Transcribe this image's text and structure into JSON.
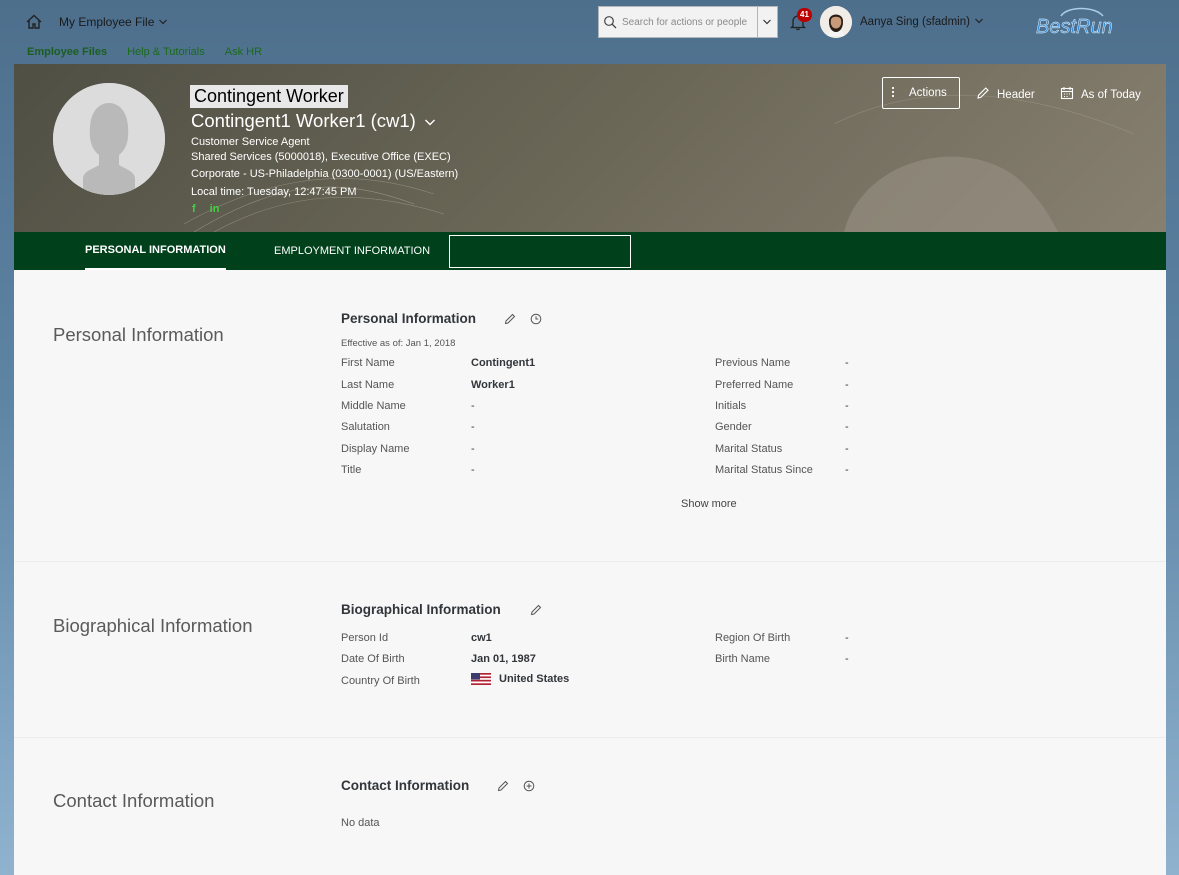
{
  "shell": {
    "menu_title": "My Employee File",
    "search_placeholder": "Search for actions or people",
    "notifications_count": "41",
    "user_name": "Aanya Sing (sfadmin)",
    "brand": "BestRun",
    "nav": [
      "Employee Files",
      "Help & Tutorials",
      "Ask HR"
    ]
  },
  "header": {
    "employee_type": "Contingent Worker",
    "employee_name": "Contingent1 Worker1 (cw1)",
    "job_title": "Customer Service Agent",
    "department": "Shared Services (5000018), Executive Office (EXEC)",
    "location": "Corporate - US-Philadelphia (0300-0001) (US/Eastern)",
    "local_time": "Local time: Tuesday, 12:47:45 PM",
    "social": [
      "f",
      "in"
    ],
    "actions_label": "Actions",
    "header_label": "Header",
    "as_of_label": "As of Today"
  },
  "tabs": [
    "PERSONAL INFORMATION",
    "EMPLOYMENT INFORMATION",
    ""
  ],
  "personal": {
    "section_title": "Personal Information",
    "block_title": "Personal Information",
    "effective": "Effective as of: Jan 1, 2018",
    "left_fields": [
      {
        "label": "First Name",
        "value": "Contingent1"
      },
      {
        "label": "Last Name",
        "value": "Worker1"
      },
      {
        "label": "Middle Name",
        "value": "-"
      },
      {
        "label": "Salutation",
        "value": "-"
      },
      {
        "label": "Display Name",
        "value": "-"
      },
      {
        "label": "Title",
        "value": "-"
      }
    ],
    "right_fields": [
      {
        "label": "Previous Name",
        "value": "-"
      },
      {
        "label": "Preferred Name",
        "value": "-"
      },
      {
        "label": "Initials",
        "value": "-"
      },
      {
        "label": "Gender",
        "value": "-"
      },
      {
        "label": "Marital Status",
        "value": "-"
      },
      {
        "label": "Marital Status Since",
        "value": "-"
      }
    ],
    "show_more": "Show more"
  },
  "biographical": {
    "section_title": "Biographical Information",
    "block_title": "Biographical Information",
    "left_fields": [
      {
        "label": "Person Id",
        "value": "cw1"
      },
      {
        "label": "Date Of Birth",
        "value": "Jan 01, 1987"
      },
      {
        "label": "Country Of Birth",
        "value": "United States"
      }
    ],
    "right_fields": [
      {
        "label": "Region Of Birth",
        "value": "-"
      },
      {
        "label": "Birth Name",
        "value": "-"
      }
    ]
  },
  "contact": {
    "section_title": "Contact Information",
    "block_title": "Contact Information",
    "no_data": "No data"
  },
  "colors": {
    "tab_bar": "#00401a",
    "nav_link": "#1b6a1b",
    "badge": "#bb0000"
  }
}
